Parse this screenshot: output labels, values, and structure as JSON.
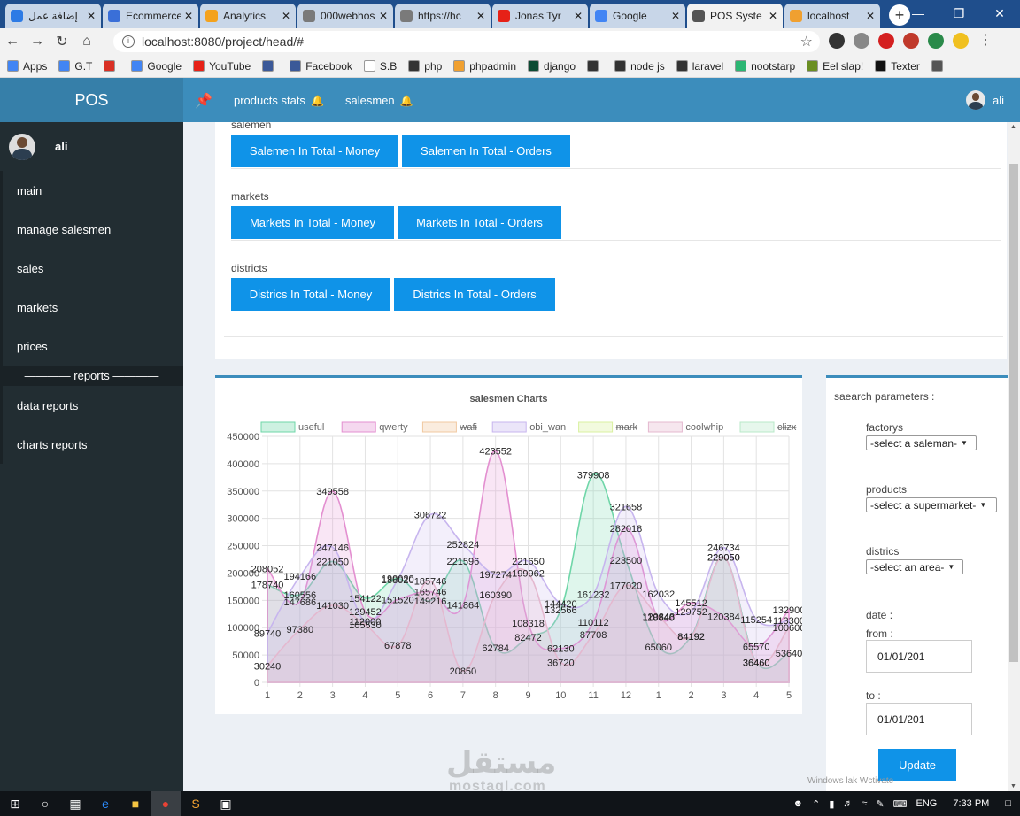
{
  "browser": {
    "tabs": [
      {
        "title": "إضافة عمل",
        "color": "#2d7be5"
      },
      {
        "title": "Ecommerce",
        "color": "#3a6fd8"
      },
      {
        "title": "Analytics",
        "color": "#f4a21d"
      },
      {
        "title": "000webhost",
        "color": "#7a7a7a"
      },
      {
        "title": "https://hc",
        "color": "#7a7a7a"
      },
      {
        "title": "Jonas Tyr",
        "color": "#e62117"
      },
      {
        "title": "Google",
        "color": "#4285f4"
      },
      {
        "title": "POS Syste",
        "color": "#555555",
        "active": true
      },
      {
        "title": "localhost",
        "color": "#f0a030"
      }
    ],
    "url": "localhost:8080/project/head/#",
    "bookmarks": [
      {
        "label": "Apps",
        "color": "#4285f4"
      },
      {
        "label": "G.T",
        "color": "#4285f4"
      },
      {
        "label": "",
        "color": "#d93025"
      },
      {
        "label": "Google",
        "color": "#4285f4"
      },
      {
        "label": "YouTube",
        "color": "#e62117"
      },
      {
        "label": "",
        "color": "#3b5998"
      },
      {
        "label": "Facebook",
        "color": "#3b5998"
      },
      {
        "label": "S.B",
        "color": "#ffffff"
      },
      {
        "label": "php",
        "color": "#333333"
      },
      {
        "label": "phpadmin",
        "color": "#f0a030"
      },
      {
        "label": "django",
        "color": "#0c4b33"
      },
      {
        "label": "",
        "color": "#333333"
      },
      {
        "label": "node js",
        "color": "#333333"
      },
      {
        "label": "laravel",
        "color": "#333333"
      },
      {
        "label": "nootstarp",
        "color": "#2bb673"
      },
      {
        "label": "Eel slap!",
        "color": "#6a8e23"
      },
      {
        "label": "Texter",
        "color": "#111111"
      },
      {
        "label": "",
        "color": "#555555"
      }
    ]
  },
  "app": {
    "brand": "POS",
    "nav": {
      "products_stats": "products stats",
      "salesmen": "salesmen",
      "user": "ali"
    },
    "sidebar": {
      "user": "ali",
      "items": [
        "main",
        "manage salesmen",
        "sales",
        "markets",
        "prices"
      ],
      "reports_label": "———— reports ————",
      "report_items": [
        "data reports",
        "charts reports"
      ]
    },
    "groups": [
      {
        "label": "salemen",
        "buttons": [
          "Salemen In Total - Money",
          "Salemen In Total - Orders"
        ]
      },
      {
        "label": "markets",
        "buttons": [
          "Markets In Total - Money",
          "Markets In Total - Orders"
        ]
      },
      {
        "label": "districts",
        "buttons": [
          "Districs In Total - Money",
          "Districs In Total - Orders"
        ]
      }
    ],
    "search": {
      "title": "saearch parameters :",
      "factorys_label": "factorys",
      "factorys_value": "-select a saleman-",
      "products_label": "products",
      "products_value": "-select a supermarket-",
      "districs_label": "districs",
      "districs_value": "-select an area-",
      "date_label": "date :",
      "from_label": "from :",
      "from_value": "01/01/201",
      "to_label": "to :",
      "to_value": "01/01/201",
      "update": "Update"
    },
    "watermark": "مستقل",
    "watermark_latin": "mostaql.com",
    "activate_text": "Windows lak Wctivate"
  },
  "taskbar": {
    "lang": "ENG",
    "time": "7:33 PM"
  },
  "chart_data": {
    "type": "area",
    "title": "salesmen Charts",
    "x": [
      "1",
      "2",
      "3",
      "4",
      "5",
      "6",
      "7",
      "8",
      "9",
      "10",
      "11",
      "12",
      "1",
      "2",
      "3",
      "4",
      "5"
    ],
    "ylim": [
      0,
      450000
    ],
    "yticks": [
      0,
      50000,
      100000,
      150000,
      200000,
      250000,
      300000,
      350000,
      400000,
      450000
    ],
    "ytick_labels": [
      "0",
      "50000",
      "100000",
      "150000",
      "200000",
      "250000",
      "300000",
      "350000",
      "400000",
      "450000"
    ],
    "grid": true,
    "legend_position": "top",
    "series": [
      {
        "name": "useful",
        "hidden": false,
        "color": "#6fd6a8",
        "values": [
          178740,
          160556,
          221050,
          154122,
          190020,
          149216,
          221596,
          62784,
          82472,
          132566,
          379908,
          223500,
          65060,
          84192,
          229050,
          36460,
          53640
        ]
      },
      {
        "name": "qwerty",
        "hidden": false,
        "color": "#e38fd0",
        "values": [
          208052,
          147686,
          349558,
          129452,
          151520,
          165746,
          141864,
          423552,
          108318,
          62130,
          110112,
          282018,
          118840,
          145512,
          120384,
          65570,
          132900
        ]
      },
      {
        "name": "wafi",
        "hidden": true,
        "color": "#f0c9a0",
        "values": []
      },
      {
        "name": "obi_wan",
        "hidden": false,
        "color": "#c7b5ee",
        "values": [
          89740,
          194166,
          247146,
          112000,
          188020,
          306722,
          252824,
          197274,
          221650,
          144420,
          161232,
          321658,
          162032,
          129752,
          246734,
          115254,
          113300
        ]
      },
      {
        "name": "mark",
        "hidden": true,
        "color": "#d9f0a0",
        "values": []
      },
      {
        "name": "coolwhip",
        "hidden": false,
        "color": "#e4b8cf",
        "values": [
          30240,
          97380,
          141030,
          105530,
          67878,
          185746,
          20850,
          160390,
          199962,
          36720,
          87708,
          177020,
          120848,
          84192,
          229050,
          36460,
          100600
        ]
      },
      {
        "name": "clizx",
        "hidden": true,
        "color": "#b8e8c8",
        "values": []
      }
    ]
  }
}
